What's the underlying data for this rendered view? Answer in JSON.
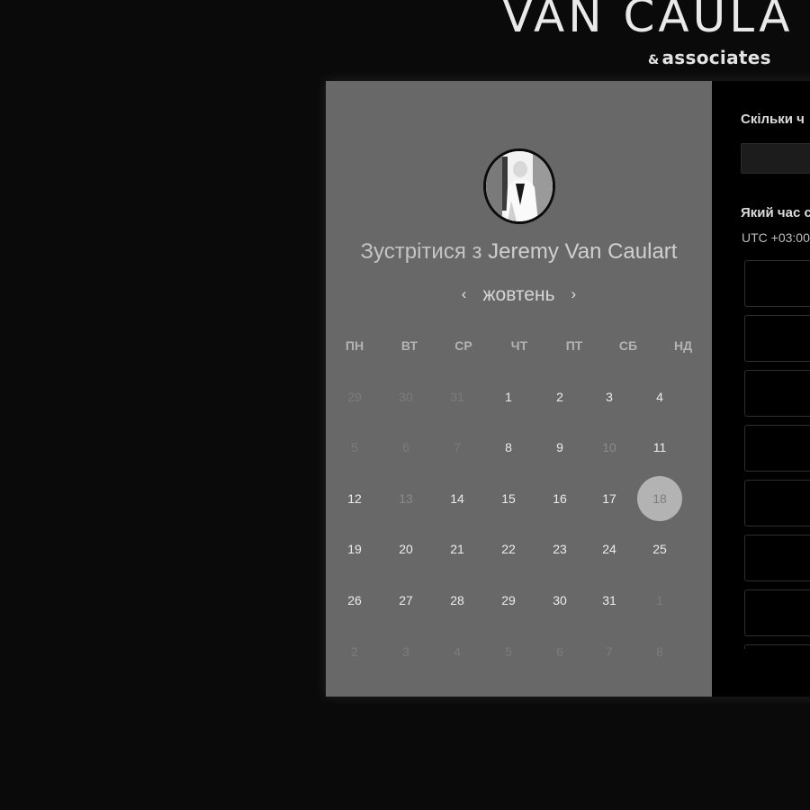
{
  "brand": {
    "title": "VAN CAULA",
    "sub_amp": "&",
    "sub_text": "associates"
  },
  "calendar": {
    "meet_prefix": "Зустрітися з",
    "meet_name": "Jeremy Van Caulart",
    "month": "жовтень",
    "prev_icon": "‹",
    "next_icon": "›",
    "weekdays": [
      "ПН",
      "ВТ",
      "СР",
      "ЧТ",
      "ПТ",
      "СБ",
      "НД"
    ],
    "weeks": [
      [
        {
          "d": "29",
          "s": "muted"
        },
        {
          "d": "30",
          "s": "muted"
        },
        {
          "d": "31",
          "s": "muted"
        },
        {
          "d": "1",
          "s": "active"
        },
        {
          "d": "2",
          "s": "active"
        },
        {
          "d": "3",
          "s": "active"
        },
        {
          "d": "4",
          "s": "active"
        }
      ],
      [
        {
          "d": "5",
          "s": "muted"
        },
        {
          "d": "6",
          "s": "muted"
        },
        {
          "d": "7",
          "s": "muted"
        },
        {
          "d": "8",
          "s": "active"
        },
        {
          "d": "9",
          "s": "active"
        },
        {
          "d": "10",
          "s": "off"
        },
        {
          "d": "11",
          "s": "active"
        }
      ],
      [
        {
          "d": "12",
          "s": "active"
        },
        {
          "d": "13",
          "s": "off"
        },
        {
          "d": "14",
          "s": "active"
        },
        {
          "d": "15",
          "s": "active"
        },
        {
          "d": "16",
          "s": "active"
        },
        {
          "d": "17",
          "s": "active"
        },
        {
          "d": "18",
          "s": "today"
        }
      ],
      [
        {
          "d": "19",
          "s": "active"
        },
        {
          "d": "20",
          "s": "active"
        },
        {
          "d": "21",
          "s": "active"
        },
        {
          "d": "22",
          "s": "active"
        },
        {
          "d": "23",
          "s": "active"
        },
        {
          "d": "24",
          "s": "active"
        },
        {
          "d": "25",
          "s": "active"
        }
      ],
      [
        {
          "d": "26",
          "s": "active"
        },
        {
          "d": "27",
          "s": "active"
        },
        {
          "d": "28",
          "s": "active"
        },
        {
          "d": "29",
          "s": "active"
        },
        {
          "d": "30",
          "s": "active"
        },
        {
          "d": "31",
          "s": "active"
        },
        {
          "d": "1",
          "s": "muted"
        }
      ],
      [
        {
          "d": "2",
          "s": "muted"
        },
        {
          "d": "3",
          "s": "muted"
        },
        {
          "d": "4",
          "s": "muted"
        },
        {
          "d": "5",
          "s": "muted"
        },
        {
          "d": "6",
          "s": "muted"
        },
        {
          "d": "7",
          "s": "muted"
        },
        {
          "d": "8",
          "s": "muted"
        }
      ]
    ]
  },
  "right_panel": {
    "duration_label": "Скільки ч",
    "time_label": "Який час с",
    "timezone": "UTC +03:00",
    "slots": [
      "",
      "",
      "",
      "",
      "",
      "",
      "",
      ""
    ]
  },
  "colors": {
    "page_bg": "#0a0a0a",
    "left_pane_bg": "#686868",
    "right_pane_bg": "#000000",
    "today_highlight": "#b3b3b3"
  }
}
